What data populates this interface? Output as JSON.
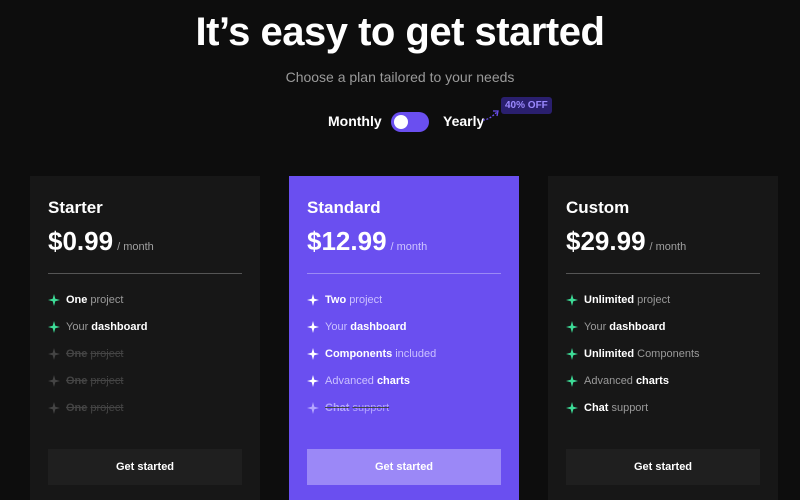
{
  "header": {
    "headline": "It’s easy to get started",
    "subtitle": "Choose a plan tailored to your needs"
  },
  "billing_toggle": {
    "monthly_label": "Monthly",
    "yearly_label": "Yearly",
    "selected": "Monthly",
    "discount_badge": "40% OFF"
  },
  "colors": {
    "accent": "#6a4ff0",
    "feature_icon": "#3ddc97",
    "background": "#0d0d0d",
    "card": "#171717"
  },
  "plans": [
    {
      "name": "Starter",
      "price": "$0.99",
      "period": "/ month",
      "cta": "Get started",
      "features": [
        {
          "strong": "One",
          "rest": "project",
          "enabled": true
        },
        {
          "lead": "Your",
          "strong": "dashboard",
          "enabled": true
        },
        {
          "strong": "One",
          "rest": "project",
          "enabled": false
        },
        {
          "strong": "One",
          "rest": "project",
          "enabled": false
        },
        {
          "strong": "One",
          "rest": "project",
          "enabled": false
        }
      ]
    },
    {
      "name": "Standard",
      "price": "$12.99",
      "period": "/ month",
      "cta": "Get started",
      "features": [
        {
          "strong": "Two",
          "rest": "project",
          "enabled": true
        },
        {
          "lead": "Your",
          "strong": "dashboard",
          "enabled": true
        },
        {
          "strong": "Components",
          "rest": "included",
          "enabled": true
        },
        {
          "lead": "Advanced",
          "strong": "charts",
          "enabled": true
        },
        {
          "strong": "Chat",
          "rest": "support",
          "enabled": false
        }
      ]
    },
    {
      "name": "Custom",
      "price": "$29.99",
      "period": "/ month",
      "cta": "Get started",
      "features": [
        {
          "strong": "Unlimited",
          "rest": "project",
          "enabled": true
        },
        {
          "lead": "Your",
          "strong": "dashboard",
          "enabled": true
        },
        {
          "strong": "Unlimited",
          "rest": "Components",
          "enabled": true
        },
        {
          "lead": "Advanced",
          "strong": "charts",
          "enabled": true
        },
        {
          "strong": "Chat",
          "rest": "support",
          "enabled": true
        }
      ]
    }
  ]
}
